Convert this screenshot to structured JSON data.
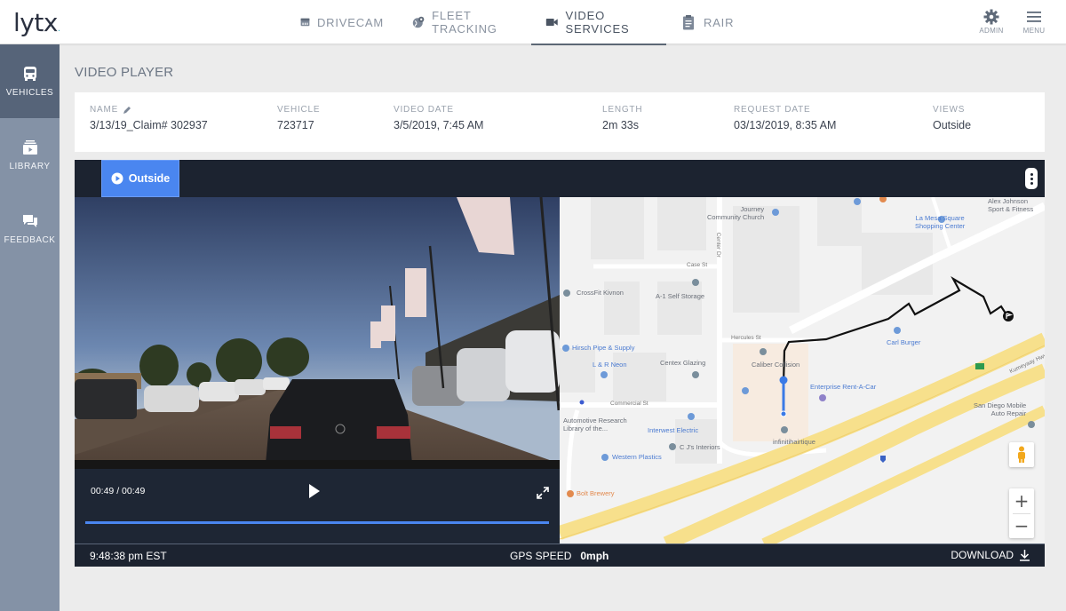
{
  "app": {
    "logo": "lytx",
    "logo_dot": "."
  },
  "nav": {
    "items": [
      {
        "label": "DRIVECAM",
        "icon": "drivecam-icon",
        "active": false
      },
      {
        "label": "FLEET TRACKING",
        "icon": "globe-pin-icon",
        "active": false
      },
      {
        "label": "VIDEO SERVICES",
        "icon": "video-camera-icon",
        "active": true
      },
      {
        "label": "RAIR",
        "icon": "clipboard-icon",
        "active": false
      }
    ],
    "admin_label": "ADMIN",
    "menu_label": "MENU"
  },
  "sidebar": {
    "items": [
      {
        "label": "VEHICLES",
        "icon": "truck-icon",
        "active": true
      },
      {
        "label": "LIBRARY",
        "icon": "library-icon",
        "active": false
      },
      {
        "label": "FEEDBACK",
        "icon": "chat-icon",
        "active": false
      }
    ]
  },
  "page": {
    "title": "VIDEO PLAYER"
  },
  "info": {
    "name_label": "NAME",
    "name_value": "3/13/19_Claim# 302937",
    "vehicle_label": "VEHICLE",
    "vehicle_value": "723717",
    "video_date_label": "VIDEO DATE",
    "video_date_value": "3/5/2019, 7:45 AM",
    "length_label": "LENGTH",
    "length_value": "2m 33s",
    "request_date_label": "REQUEST DATE",
    "request_date_value": "03/13/2019, 8:35 AM",
    "views_label": "VIEWS",
    "views_value": "Outside"
  },
  "player": {
    "view_tab_label": "Outside",
    "time_readout": "00:49 / 00:49",
    "progress_percent": 100,
    "status_time": "9:48:38 pm EST",
    "gps_speed_label": "GPS SPEED",
    "gps_speed_value": "0mph",
    "download_label": "DOWNLOAD"
  },
  "map": {
    "places": [
      {
        "label": "Journey\nCommunity Church",
        "style": "gray"
      },
      {
        "label": "Alex Johnson\nSport & Fitness",
        "style": "gray"
      },
      {
        "label": "La Mesa Square\nShopping Center",
        "style": "blue"
      },
      {
        "label": "CrossFit Kivnon",
        "style": "gray"
      },
      {
        "label": "A-1 Self Storage",
        "style": "gray"
      },
      {
        "label": "Hirsch Pipe & Supply",
        "style": "blue"
      },
      {
        "label": "L & R Neon",
        "style": "blue"
      },
      {
        "label": "Centex Glazing",
        "style": "gray"
      },
      {
        "label": "Caliber Collision",
        "style": "gray"
      },
      {
        "label": "Carl Burger",
        "style": "blue"
      },
      {
        "label": "Enterprise Rent-A-Car",
        "style": "blue"
      },
      {
        "label": "Automotive Research\nLibrary of the...",
        "style": "gray"
      },
      {
        "label": "Interwest Electric",
        "style": "blue"
      },
      {
        "label": "C J's Interiors",
        "style": "gray"
      },
      {
        "label": "infinitihairtique",
        "style": "gray"
      },
      {
        "label": "Western Plastics",
        "style": "blue"
      },
      {
        "label": "San Diego Mobile\nAuto Repair",
        "style": "gray"
      },
      {
        "label": "Bolt Brewery",
        "style": "orange"
      }
    ],
    "streets": [
      "Case St",
      "Center Dr",
      "Hercules St",
      "Commercial St",
      "Kumeyaay Hwy"
    ],
    "zoom_in": "+",
    "zoom_out": "−"
  },
  "colors": {
    "accent": "#4a86f0",
    "player_bg": "#1c2330",
    "sidebar_bg": "#8492a6",
    "sidebar_active": "#566479"
  }
}
